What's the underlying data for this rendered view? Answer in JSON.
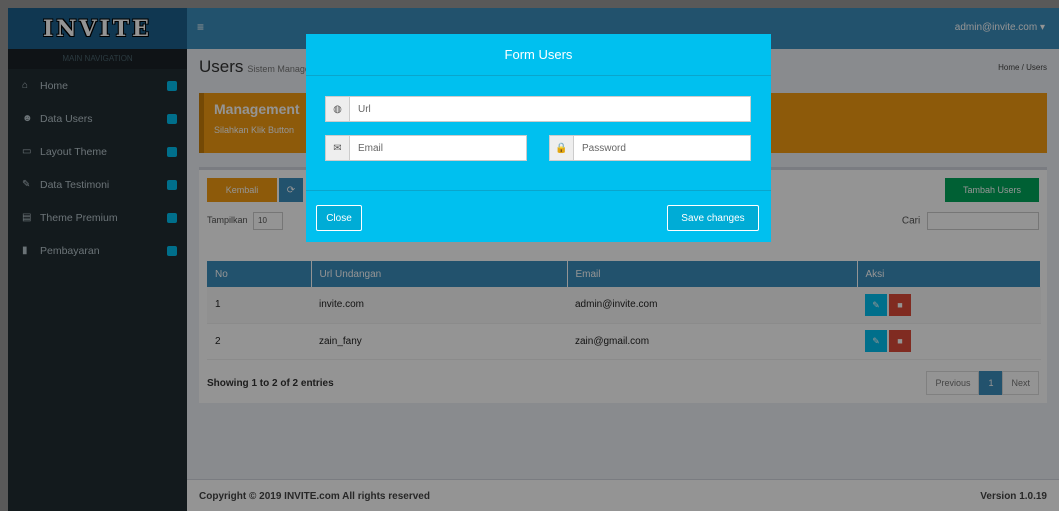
{
  "app": {
    "logo": "INVITE",
    "user": "admin@invite.com ▾",
    "menu_icon": "hamburger-icon"
  },
  "sidebar": {
    "header": "MAIN NAVIGATION",
    "items": [
      {
        "label": "Home",
        "icon": "home-icon"
      },
      {
        "label": "Data Users",
        "icon": "users-icon"
      },
      {
        "label": "Layout Theme",
        "icon": "monitor-icon"
      },
      {
        "label": "Data Testimoni",
        "icon": "edit-icon"
      },
      {
        "label": "Theme Premium",
        "icon": "table-icon"
      },
      {
        "label": "Pembayaran",
        "icon": "file-icon"
      }
    ]
  },
  "page": {
    "title": "Users",
    "subtitle": "Sistem Managemen",
    "breadcrumb_home": "Home",
    "breadcrumb_current": "Users",
    "callout_title": "Management",
    "callout_text": "Silahkan Klik Button"
  },
  "toolbar": {
    "kembali_label": "Kembali",
    "tambah_label": "Tambah Users",
    "length_label": "Tampilkan",
    "length_value": "10",
    "search_label": "Cari"
  },
  "table": {
    "headers": [
      "No",
      "Url Undangan",
      "Email",
      "Aksi"
    ],
    "rows": [
      {
        "no": "1",
        "url": "invite.com",
        "email": "admin@invite.com"
      },
      {
        "no": "2",
        "url": "zain_fany",
        "email": "zain@gmail.com"
      }
    ],
    "info": "Showing 1 to 2 of 2 entries",
    "pager": {
      "prev": "Previous",
      "page": "1",
      "next": "Next"
    }
  },
  "footer": {
    "copyright": "Copyright © 2019 INVITE.com All rights reserved",
    "version": "Version 1.0.19"
  },
  "modal": {
    "title": "Form Users",
    "url_placeholder": "Url",
    "email_placeholder": "Email",
    "password_placeholder": "Password",
    "close_label": "Close",
    "save_label": "Save changes"
  },
  "colors": {
    "modal_bg": "#00c0ef",
    "primary": "#3c8dbc",
    "warning": "#f39c12",
    "success": "#00a65a",
    "danger": "#dd4b39"
  }
}
